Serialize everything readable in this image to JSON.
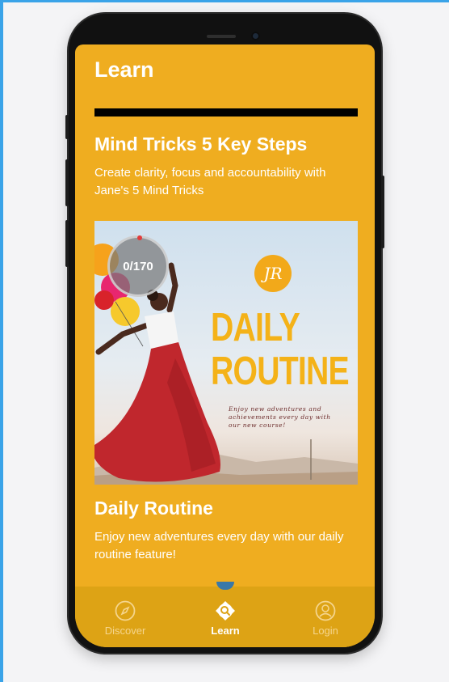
{
  "header": {
    "title": "Learn"
  },
  "course": {
    "title": "Mind Tricks 5 Key Steps",
    "description": "Create clarity, focus and accountability with Jane's 5 Mind Tricks"
  },
  "hero": {
    "progress": "0/170",
    "logo": "JR",
    "poster_line1": "DAILY",
    "poster_line2": "ROUTINE",
    "poster_sub": "Enjoy new adventures and achievements every day with our new course!"
  },
  "feature": {
    "title": "Daily Routine",
    "description": "Enjoy new adventures every day with our daily routine feature!"
  },
  "nav": {
    "tabs": [
      {
        "label": "Discover",
        "icon": "compass-icon"
      },
      {
        "label": "Learn",
        "icon": "learn-icon"
      },
      {
        "label": "Login",
        "icon": "user-icon"
      }
    ]
  },
  "colors": {
    "accent": "#efad20",
    "nav": "#dda315",
    "poster_text": "#f4b218"
  }
}
